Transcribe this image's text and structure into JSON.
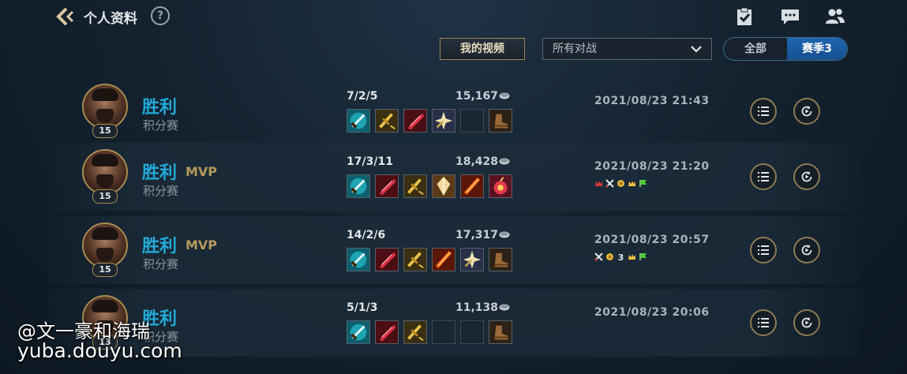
{
  "header": {
    "title": "个人资料",
    "help_label": "?",
    "icons": [
      "back-arrow-icon",
      "clipboard-check-icon",
      "chat-icon",
      "friends-icon"
    ]
  },
  "filters": {
    "video_button": "我的视频",
    "battle_select": {
      "selected": "所有对战"
    },
    "season_tabs": [
      {
        "label": "全部",
        "active": false
      },
      {
        "label": "赛季3",
        "active": true
      }
    ]
  },
  "matches": [
    {
      "level": "15",
      "result": "胜利",
      "mvp": "",
      "mode": "积分赛",
      "kda": "7/2/5",
      "gold": "15,167",
      "time": "2021/08/23 21:43",
      "items": [
        "cyan-blade",
        "gold-sword",
        "red-crystal-blade",
        "star-spear",
        "empty",
        "boots"
      ],
      "badges": []
    },
    {
      "level": "15",
      "result": "胜利",
      "mvp": "MVP",
      "mode": "积分赛",
      "kda": "17/3/11",
      "gold": "18,428",
      "time": "2021/08/23 21:20",
      "items": [
        "cyan-blade",
        "red-crystal-blade",
        "gold-sword",
        "light-axe",
        "fire-blade",
        "bomb"
      ],
      "badges": [
        "red-crown",
        "crossed-swords",
        "gold-coin",
        "gold-crown",
        "green-flag"
      ]
    },
    {
      "level": "15",
      "result": "胜利",
      "mvp": "MVP",
      "mode": "积分赛",
      "kda": "14/2/6",
      "gold": "17,317",
      "time": "2021/08/23 20:57",
      "items": [
        "cyan-blade",
        "red-crystal-blade",
        "gold-sword",
        "fire-blade",
        "star-spear",
        "boots"
      ],
      "badges": [
        "crossed-swords",
        "gold-coin",
        "triple",
        "gold-crown",
        "green-flag"
      ]
    },
    {
      "level": "13",
      "result": "胜利",
      "mvp": "",
      "mode": "积分赛",
      "kda": "5/1/3",
      "gold": "11,138",
      "time": "2021/08/23 20:06",
      "items": [
        "cyan-blade",
        "red-crystal-blade",
        "gold-sword",
        "empty",
        "empty",
        "boots"
      ],
      "badges": []
    }
  ],
  "watermark": {
    "line1": "@文一豪和海瑞",
    "line2": "yuba.douyu.com"
  },
  "colors": {
    "win": "#22a9d6",
    "mvp": "#b49a5b",
    "accent_gold": "#8c7a54",
    "season_active": "#1f66b0"
  }
}
